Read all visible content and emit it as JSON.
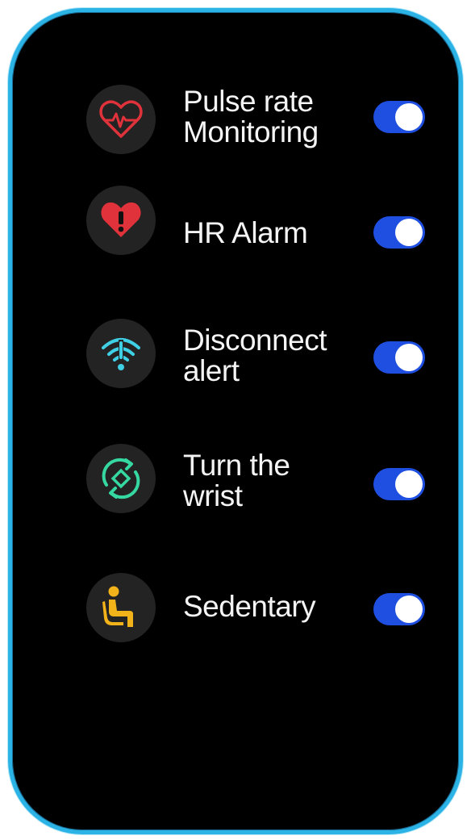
{
  "settings": [
    {
      "line1": "Pulse rate",
      "line2": "Monitoring",
      "icon": "heartbeat-icon",
      "color": "#e0323a",
      "enabled": true
    },
    {
      "line1": "HR Alarm",
      "line2": "",
      "icon": "heart-alert-icon",
      "color": "#e0323a",
      "enabled": true
    },
    {
      "line1": "Disconnect",
      "line2": "alert",
      "icon": "disconnect-signal-icon",
      "color": "#3fd0e6",
      "enabled": true
    },
    {
      "line1": "Turn the",
      "line2": "wrist",
      "icon": "rotate-wrist-icon",
      "color": "#35d8a0",
      "enabled": true
    },
    {
      "line1": "Sedentary",
      "line2": "",
      "icon": "sitting-person-icon",
      "color": "#f2b21a",
      "enabled": true
    }
  ],
  "toggle_color": "#1f4fe0"
}
